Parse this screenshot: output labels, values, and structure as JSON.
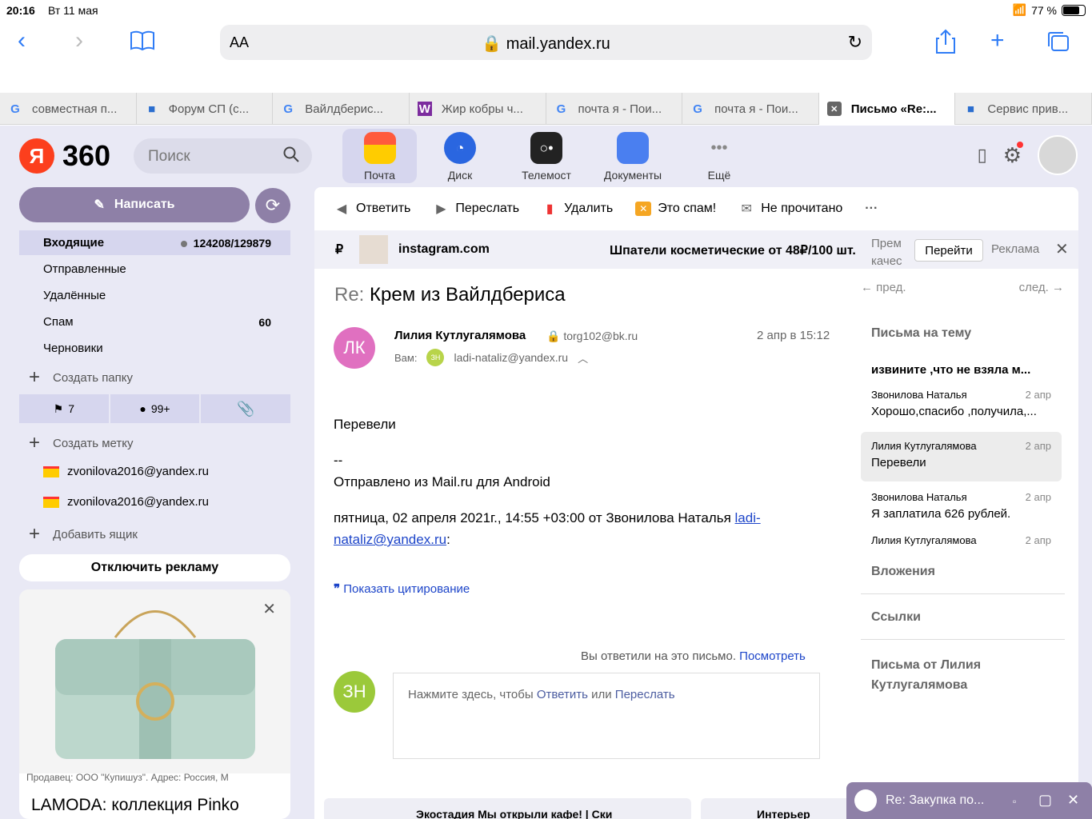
{
  "status": {
    "time": "20:16",
    "date": "Вт 11 мая",
    "battery": "77 %"
  },
  "browser": {
    "text_size": "AA",
    "url": "mail.yandex.ru"
  },
  "tabs": [
    {
      "label": "совместная п...",
      "fav": "G",
      "color": "#4285f4"
    },
    {
      "label": "Форум СП (с...",
      "fav": "■",
      "color": "#2b6ecf"
    },
    {
      "label": "Вайлдберис...",
      "fav": "G",
      "color": "#4285f4"
    },
    {
      "label": "Жир кобры ч...",
      "fav": "W",
      "color": "#7c2c9e"
    },
    {
      "label": "почта я - Пои...",
      "fav": "G",
      "color": "#4285f4"
    },
    {
      "label": "почта я - Пои...",
      "fav": "G",
      "color": "#4285f4"
    },
    {
      "label": "Письмо «Re:...",
      "fav": "✕",
      "color": "#555555"
    },
    {
      "label": "Сервис прив...",
      "fav": "■",
      "color": "#2b6ecf"
    }
  ],
  "header": {
    "logo_letter": "Я",
    "logo_text": "360",
    "search_placeholder": "Поиск",
    "services": [
      {
        "label": "Почта",
        "color": "#ffcc00"
      },
      {
        "label": "Диск",
        "color": "#2a66e0"
      },
      {
        "label": "Телемост",
        "color": "#222222"
      },
      {
        "label": "Документы",
        "color": "#4a7ff0"
      },
      {
        "label": "Ещё",
        "color": "#ffffff"
      }
    ]
  },
  "sidebar": {
    "compose": "Написать",
    "folders": [
      {
        "label": "Входящие",
        "count": "124208/129879"
      },
      {
        "label": "Отправленные",
        "count": ""
      },
      {
        "label": "Удалённые",
        "count": ""
      },
      {
        "label": "Спам",
        "count": "60"
      },
      {
        "label": "Черновики",
        "count": ""
      }
    ],
    "create_folder": "Создать папку",
    "filters": {
      "flagged": "7",
      "unread": "99+"
    },
    "create_label": "Создать метку",
    "mailboxes": [
      "zvonilova2016@yandex.ru",
      "zvonilova2016@yandex.ru"
    ],
    "add_mailbox": "Добавить ящик",
    "disable_ads": "Отключить рекламу",
    "ad": {
      "seller": "Продавец: ООО \"Купишуз\". Адрес: Россия, М",
      "title": "LAMODA: коллекция Pinko"
    }
  },
  "letter": {
    "actions": [
      "Ответить",
      "Переслать",
      "Удалить",
      "Это спам!",
      "Не прочитано"
    ],
    "more": "···",
    "ad": {
      "currency": "₽",
      "domain": "instagram.com",
      "headline": "Шпатели косметические от 48₽/100 шт.",
      "prem_line1": "Прем",
      "prem_line2": "качес",
      "go": "Перейти",
      "label": "Реклама"
    },
    "subject_prefix": "Re:",
    "subject": "Крем из Вайлдбериса",
    "sender_initials": "ЛК",
    "sender": "Лилия Кутлугалямова",
    "sender_email": "torg102@bk.ru",
    "date": "2 апр в 15:12",
    "to_label": "Вам:",
    "to_initials": "ЗН",
    "to_email": "ladi-nataliz@yandex.ru",
    "body_line1": "Перевели",
    "body_sig_dash": "--",
    "body_sig": "Отправлено из Mail.ru для Android",
    "body_quote_head": "пятница, 02 апреля 2021г., 14:55 +03:00 от Звонилова Наталья ",
    "body_quote_link1": "ladi-",
    "body_quote_link2": "nataliz@yandex.ru",
    "body_quote_colon": ":",
    "show_quote": "Показать цитирование",
    "replied_text": "Вы ответили на это письмо.",
    "replied_link": "Посмотреть",
    "reply_initials": "ЗН",
    "reply_ph_1": "Нажмите здесь, чтобы ",
    "reply_ph_reply": "Ответить",
    "reply_ph_or": " или ",
    "reply_ph_forward": "Переслать",
    "bottom_card1": "Экостадия  Мы открыли кафе! | Ски",
    "bottom_card2": "Интерьер"
  },
  "thread": {
    "prev": "пред.",
    "next": "след.",
    "title": "Письма на тему",
    "subject": "извините ,что не взяла м...",
    "messages": [
      {
        "from": "Звонилова Наталья",
        "date": "2 апр",
        "text": "Хорошо,спасибо ,получила,..."
      },
      {
        "from": "Лилия Кутлугалямова",
        "date": "2 апр",
        "text": "Перевели"
      },
      {
        "from": "Звонилова Наталья",
        "date": "2 апр",
        "text": "Я заплатила 626 рублей."
      },
      {
        "from": "Лилия Кутлугалямова",
        "date": "2 апр",
        "text": ""
      }
    ],
    "attachments": "Вложения",
    "links": "Ссылки",
    "letters_from_1": "Письма от Лилия",
    "letters_from_2": "Кутлугалямова"
  },
  "popup": {
    "title": "Re: Закупка по..."
  }
}
